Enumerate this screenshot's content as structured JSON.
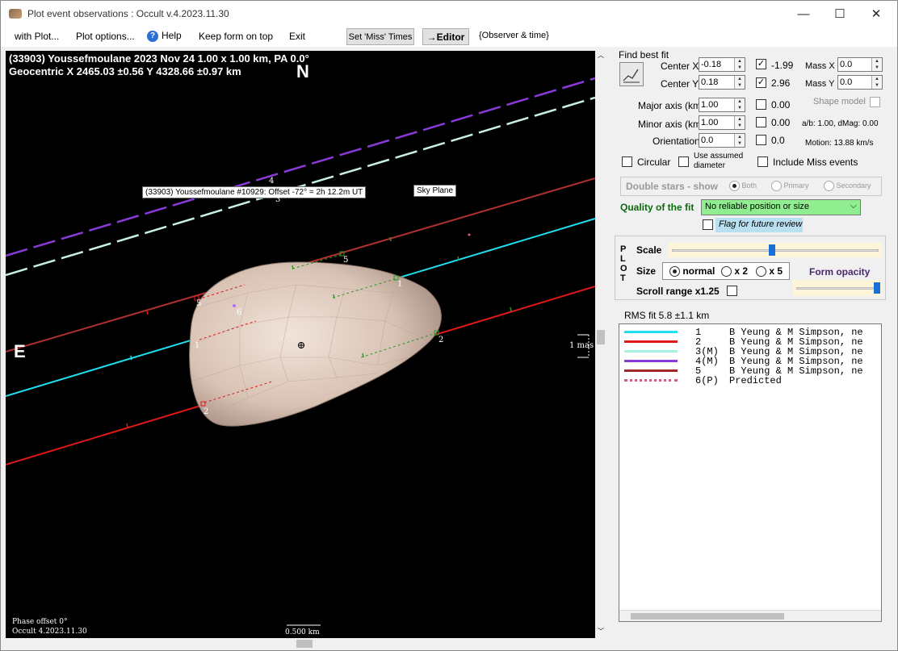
{
  "window": {
    "title": "Plot event observations : Occult v.4.2023.11.30",
    "minimize": "—",
    "maximize": "☐",
    "close": "✕"
  },
  "menu": {
    "with_plot": "with Plot...",
    "plot_options": "Plot options...",
    "help": "Help",
    "keep_on_top": "Keep form on top",
    "exit": "Exit",
    "set_miss_times": "Set 'Miss' Times",
    "editor": "→Editor",
    "observer_time": "{Observer & time}"
  },
  "plot": {
    "header_line1": "(33903) Youssefmoulane  2023 Nov 24   1.00 x 1.00 km,  PA 0.0°",
    "header_line2": "Geocentric  X  2465.03 ±0.56  Y 4328.66 ±0.97 km",
    "north_label": "N",
    "east_label": "E",
    "event_label": "(33903) Youssefmoulane #10929: Offset -72° =  2h 12.2m UT",
    "sky_plane_label": "Sky Plane",
    "mas_scale": "1 mas",
    "km_scale": "0.500 km",
    "phase_offset": "Phase offset 0°",
    "version": "Occult 4.2023.11.30",
    "chord_numbers": [
      "1",
      "2",
      "3",
      "4",
      "5",
      "6",
      "1",
      "2",
      "5"
    ]
  },
  "fit": {
    "find_best_fit": "Find best fit",
    "center_x_label": "Center X",
    "center_x_value": "-0.18",
    "center_x_check_value": "-1.99",
    "center_y_label": "Center Y",
    "center_y_value": "0.18",
    "center_y_check_value": "2.96",
    "mass_x_label": "Mass X",
    "mass_x_value": "0.0",
    "mass_y_label": "Mass Y",
    "mass_y_value": "0.0",
    "major_axis_label": "Major axis (km)",
    "major_axis_value": "1.00",
    "major_check_value": "0.00",
    "shape_model_label": "Shape model",
    "minor_axis_label": "Minor axis (km)",
    "minor_axis_value": "1.00",
    "minor_check_value": "0.00",
    "ab_dmag": "a/b: 1.00, dMag: 0.00",
    "orientation_label": "Orientation",
    "orientation_value": "0.0",
    "orientation_check_value": "0.0",
    "motion": "Motion: 13.88 km/s",
    "circular_label": "Circular",
    "use_assumed_label": "Use assumed diameter",
    "include_miss_label": "Include Miss events",
    "double_stars_label": "Double stars - show",
    "both_label": "Both",
    "primary_label": "Primary",
    "secondary_label": "Secondary",
    "quality_label": "Quality of the fit",
    "quality_value": "No reliable position or size",
    "flag_label": "Flag for future review"
  },
  "plot_panel": {
    "vertical_label": "P\nL\nO\nT",
    "scale_label": "Scale",
    "size_label": "Size",
    "size_normal": "normal",
    "size_x2": "x 2",
    "size_x5": "x 5",
    "form_opacity_label": "Form opacity",
    "scroll_range_label": "Scroll range x1.25"
  },
  "rms_fit": "RMS fit 5.8 ±1.1 km",
  "legend": [
    {
      "num": "1",
      "text": "B Yeung & M Simpson, ne",
      "color": "#20e0f0",
      "style": "solid"
    },
    {
      "num": "2",
      "text": "B Yeung & M Simpson, ne",
      "color": "#e01818",
      "style": "solid"
    },
    {
      "num": "3(M)",
      "text": "B Yeung & M Simpson, ne",
      "color": "#a8f0e0",
      "style": "solid"
    },
    {
      "num": "4(M)",
      "text": "B Yeung & M Simpson, ne",
      "color": "#8a3ad8",
      "style": "solid"
    },
    {
      "num": "5",
      "text": "B Yeung & M Simpson, ne",
      "color": "#a02828",
      "style": "solid"
    },
    {
      "num": "6(P)",
      "text": "Predicted",
      "color": "#d06080",
      "style": "dotted"
    }
  ],
  "colors": {
    "chord1": "#20e0f0",
    "chord2": "#e01818",
    "chord3": "#c8f0e8",
    "chord4": "#8a3ad8",
    "chord5": "#b03030",
    "asteroid": "#dcc8bc",
    "quality_bg": "#90ee90"
  }
}
